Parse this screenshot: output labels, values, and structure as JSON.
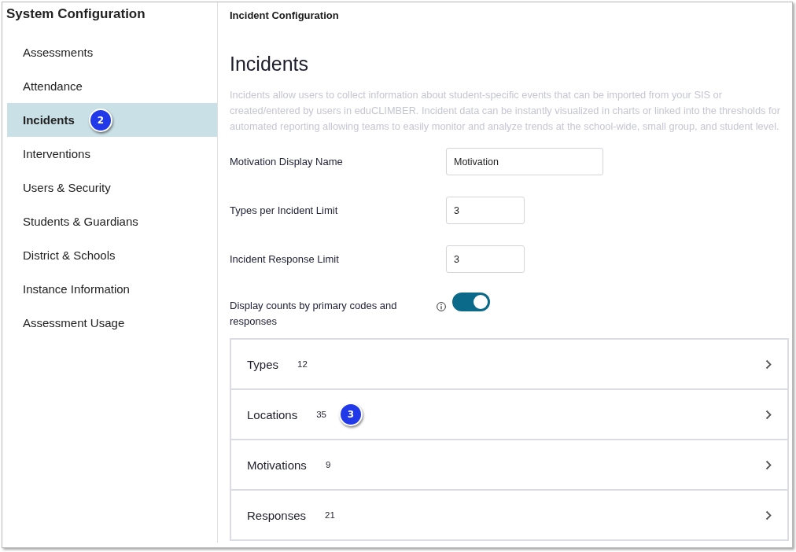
{
  "sidebar": {
    "title": "System Configuration",
    "items": [
      {
        "label": "Assessments",
        "selected": false
      },
      {
        "label": "Attendance",
        "selected": false
      },
      {
        "label": "Incidents",
        "selected": true,
        "callout": "2"
      },
      {
        "label": "Interventions",
        "selected": false
      },
      {
        "label": "Users & Security",
        "selected": false
      },
      {
        "label": "Students & Guardians",
        "selected": false
      },
      {
        "label": "District & Schools",
        "selected": false
      },
      {
        "label": "Instance Information",
        "selected": false
      },
      {
        "label": "Assessment Usage",
        "selected": false
      }
    ]
  },
  "main": {
    "breadcrumb": "Incident Configuration",
    "heading": "Incidents",
    "description": "Incidents allow users to collect information about student-specific events that can be imported from your SIS or created/entered by users in eduCLIMBER. Incident data can be instantly visualized in charts or linked into the thresholds for automated reporting allowing teams to easily monitor and analyze trends at the school-wide, small group, and student level.",
    "fields": [
      {
        "kind": "text",
        "label": "Motivation Display Name",
        "value": "Motivation"
      },
      {
        "kind": "number",
        "label": "Types per Incident Limit",
        "value": "3"
      },
      {
        "kind": "number",
        "label": "Incident Response Limit",
        "value": "3"
      },
      {
        "kind": "toggle",
        "label": "Display counts by primary codes and responses",
        "on": true
      }
    ],
    "sections": [
      {
        "label": "Types",
        "count": "12"
      },
      {
        "label": "Locations",
        "count": "35",
        "callout": "3"
      },
      {
        "label": "Motivations",
        "count": "9"
      },
      {
        "label": "Responses",
        "count": "21"
      }
    ]
  }
}
